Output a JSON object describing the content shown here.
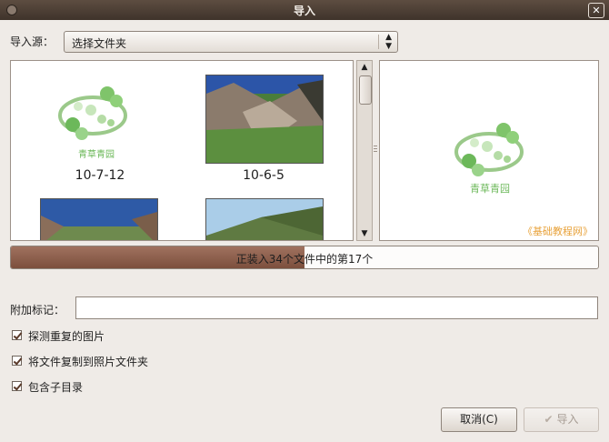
{
  "window": {
    "title": "导入"
  },
  "source": {
    "label": "导入源：",
    "value": "选择文件夹"
  },
  "thumbnails": [
    {
      "label": "10-7-12"
    },
    {
      "label": "10-6-5"
    }
  ],
  "logo_text": "青草青园",
  "preview": {
    "watermark": "《基础教程网》"
  },
  "progress": {
    "text": "正装入34个文件中的第17个",
    "current": 17,
    "total": 34
  },
  "tags": {
    "label": "附加标记：",
    "value": ""
  },
  "options": [
    {
      "label": "探测重复的图片",
      "checked": true
    },
    {
      "label": "将文件复制到照片文件夹",
      "checked": true
    },
    {
      "label": "包含子目录",
      "checked": true
    }
  ],
  "buttons": {
    "cancel": "取消(C)",
    "import": "导入"
  }
}
